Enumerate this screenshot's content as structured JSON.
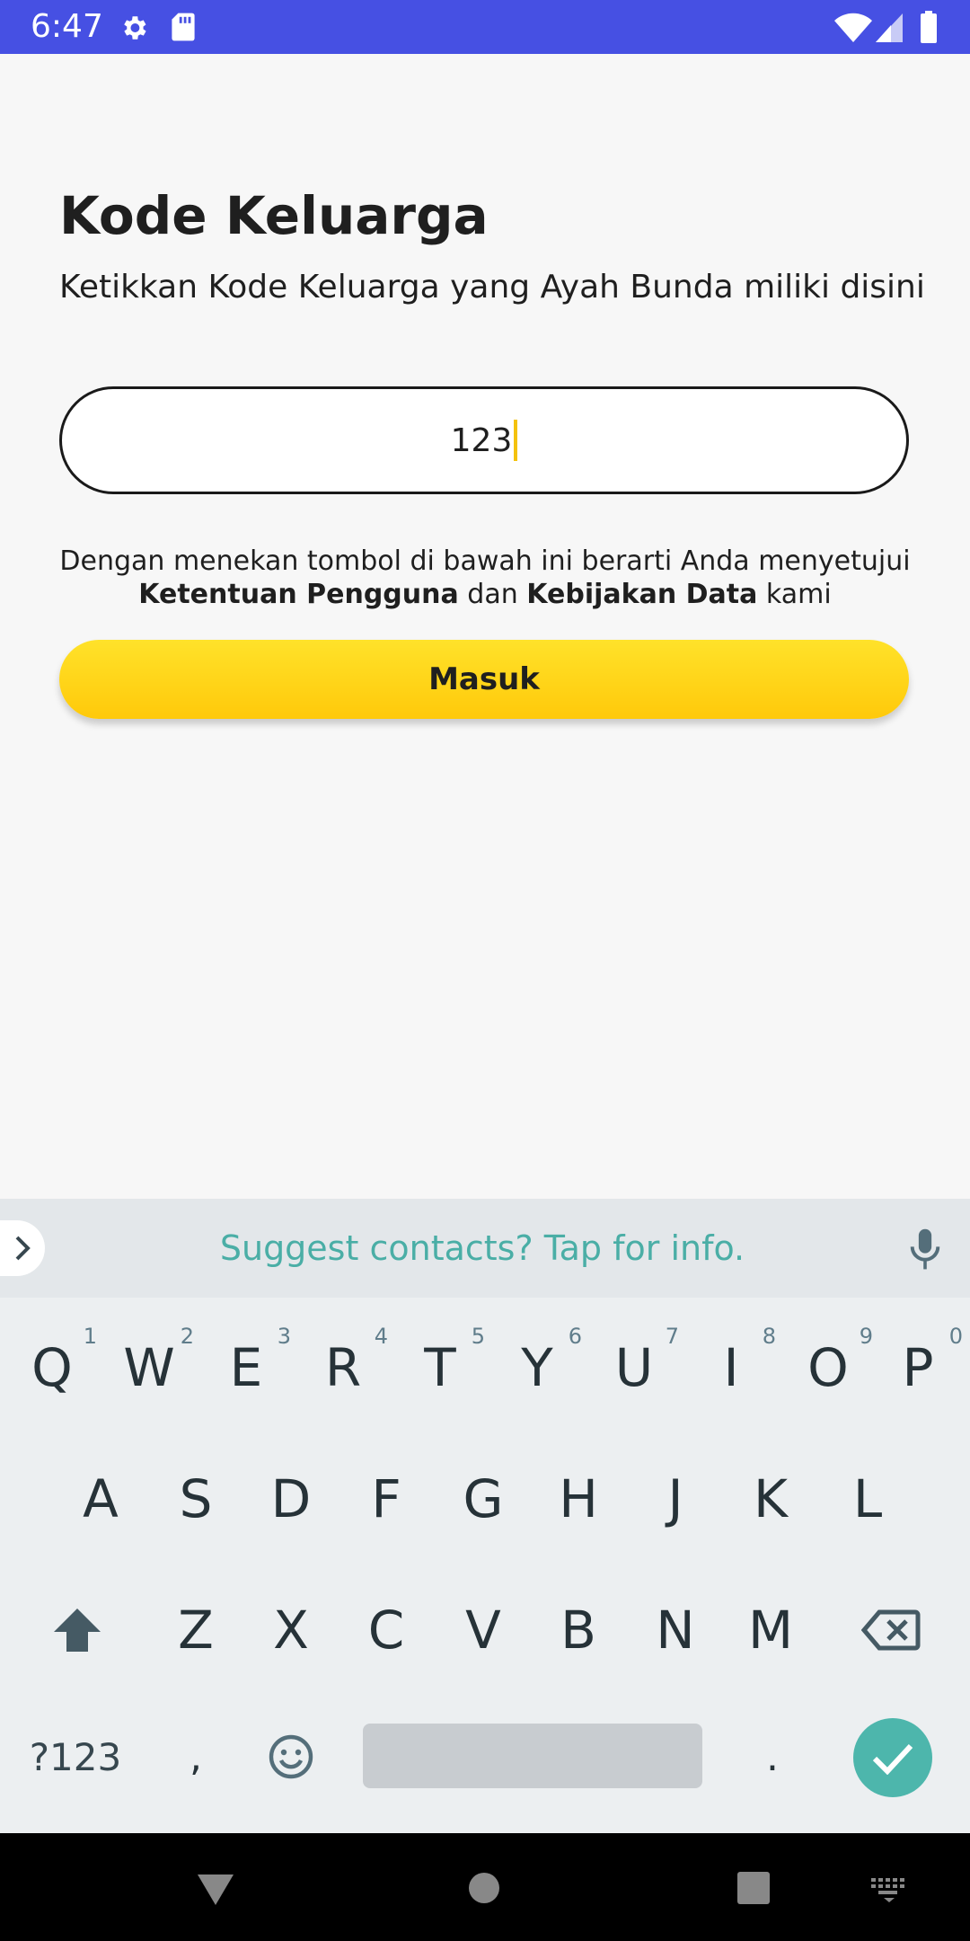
{
  "status_bar": {
    "time": "6:47",
    "icons": [
      "gear-icon",
      "sd-card-icon",
      "wifi-icon",
      "cell-signal-icon",
      "battery-icon"
    ],
    "color": "#4650e3"
  },
  "page": {
    "title": "Kode Keluarga",
    "subtitle": "Ketikkan Kode Keluarga yang Ayah Bunda miliki disini",
    "code_input": {
      "value": "123"
    },
    "terms": {
      "prefix": "Dengan menekan tombol di bawah ini berarti Anda menyetujui",
      "link1": "Ketentuan Pengguna",
      "middle": "dan",
      "link2": "Kebijakan Data",
      "suffix": "kami"
    },
    "login_button": "Masuk",
    "accent_color": "#ffd21a"
  },
  "keyboard": {
    "suggestion": "Suggest contacts? Tap for info.",
    "row1": [
      {
        "key": "Q",
        "hint": "1"
      },
      {
        "key": "W",
        "hint": "2"
      },
      {
        "key": "E",
        "hint": "3"
      },
      {
        "key": "R",
        "hint": "4"
      },
      {
        "key": "T",
        "hint": "5"
      },
      {
        "key": "Y",
        "hint": "6"
      },
      {
        "key": "U",
        "hint": "7"
      },
      {
        "key": "I",
        "hint": "8"
      },
      {
        "key": "O",
        "hint": "9"
      },
      {
        "key": "P",
        "hint": "0"
      }
    ],
    "row2": [
      "A",
      "S",
      "D",
      "F",
      "G",
      "H",
      "J",
      "K",
      "L"
    ],
    "row3": [
      "Z",
      "X",
      "C",
      "V",
      "B",
      "N",
      "M"
    ],
    "symbols_key": "?123",
    "comma_key": ",",
    "period_key": ".",
    "enter_color": "#4db6ac"
  }
}
